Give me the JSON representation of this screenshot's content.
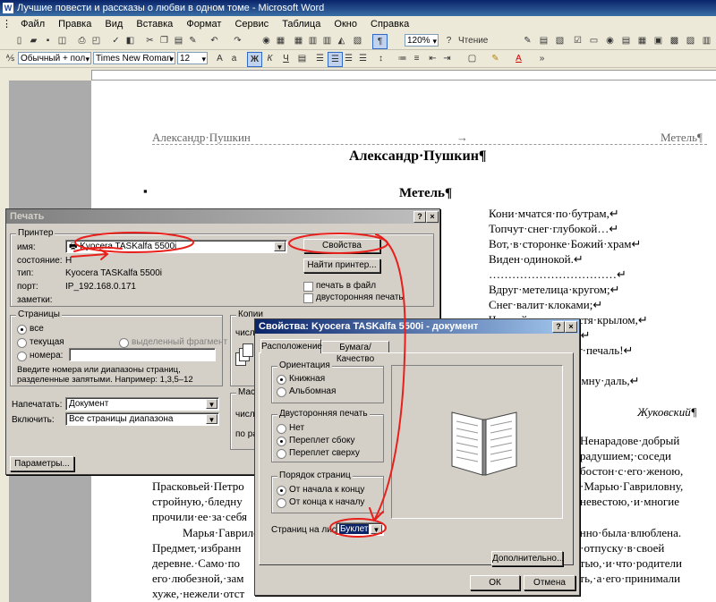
{
  "window": {
    "title": "Лучшие повести и рассказы о любви в одном томе - Microsoft Word"
  },
  "menu": [
    "Файл",
    "Правка",
    "Вид",
    "Вставка",
    "Формат",
    "Сервис",
    "Таблица",
    "Окно",
    "Справка"
  ],
  "toolbar": {
    "zoom": "120%",
    "reading_label": "Чтение"
  },
  "format_bar": {
    "style": "Обычный + пол",
    "font": "Times New Roman",
    "size": "12"
  },
  "document": {
    "header_left": "Александр·Пушкин",
    "header_tab": "→",
    "header_right": "Метель¶",
    "heading": "Александр·Пушкин¶",
    "subheading": "Метель¶",
    "bullet": "▪",
    "poem": [
      "Кони·мчатся·по·бутрам,↵",
      "Топчут·снег·глубокой…↵",
      "Вот,·в·сторонке·Божий·храм↵",
      "Виден·одинокой.↵",
      "……………………………↵",
      "Вдруг·метелица·кругом;↵",
      "Снег·валит·клоками;↵",
      "Черный·вран,·свистя·крылом,↵",
      "й;↵",
      "нт·печаль!↵",
      "↵",
      "темну·даль,↵",
      "…¶"
    ],
    "attribution": "Жуковский¶",
    "prose_right": [
      "Ненарадове·добрый",
      "радушием;·соседи",
      "бостон·с·его·женою,",
      "·Марью·Гавриловну,",
      "невестою,·и·многие"
    ],
    "prose_left": [
      "Прасковьей·Петро",
      "стройную,·бледну",
      "прочили·ее·за·себя"
    ],
    "prose_bottom_left": [
      "Марья·Гаврило",
      "Предмет,·избранн",
      "деревне.·Само·по",
      "его·любезной,·зам",
      "хуже,·нежели·отст"
    ],
    "prose_bottom_right": [
      "енно·была·влюблена.",
      "в·отпуску·в·своей",
      "стью,·и·что·родители",
      "ать,·а·его·принимали"
    ]
  },
  "print_dialog": {
    "title": "Печать",
    "printer_group": "Принтер",
    "name_label": "имя:",
    "printer_name": "Kyocera TASKalfa 5500i",
    "status_label": "состояние:",
    "status_value": "Н",
    "type_label": "тип:",
    "type_value": "Kyocera TASKalfa 5500i",
    "port_label": "порт:",
    "port_value": "IP_192.168.0.171",
    "notes_label": "заметки:",
    "properties_button": "Свойства",
    "find_printer_button": "Найти принтер...",
    "print_to_file": "печать в файл",
    "duplex": "двусторонняя печать",
    "pages_group": "Страницы",
    "all": "все",
    "current": "текущая",
    "selection": "выделенный фрагмент",
    "pages": "номера:",
    "pages_hint": "Введите номера или диапазоны страниц, разделенные запятыми. Например: 1,3,5–12",
    "copies_group": "Копии",
    "copies_label": "числ",
    "scale_group": "Масш",
    "scale_label1": "числ",
    "scale_label2": "по раз",
    "print_what_label": "Напечатать:",
    "print_what_value": "Документ",
    "include_label": "Включить:",
    "include_value": "Все страницы диапазона",
    "params_button": "Параметры..."
  },
  "props_dialog": {
    "title": "Свойства: Kyocera TASKalfa 5500i - документ",
    "tab_layout": "Расположение",
    "tab_paper": "Бумага/Качество",
    "orientation_group": "Ориентация",
    "portrait": "Книжная",
    "landscape": "Альбомная",
    "duplex_group": "Двусторонняя печать",
    "no": "Нет",
    "flip_long": "Переплет сбоку",
    "flip_short": "Переплет сверху",
    "order_group": "Порядок страниц",
    "front_to_back": "От начала к концу",
    "back_to_front": "От конца к началу",
    "pages_per_sheet_label": "Страниц на листе:",
    "pages_per_sheet_value": "Буклет",
    "advanced_button": "Дополнительно...",
    "ok_button": "ОК",
    "cancel_button": "Отмена"
  },
  "colors": {
    "annotation": "#e8201c",
    "active_title": "#0a246a"
  }
}
